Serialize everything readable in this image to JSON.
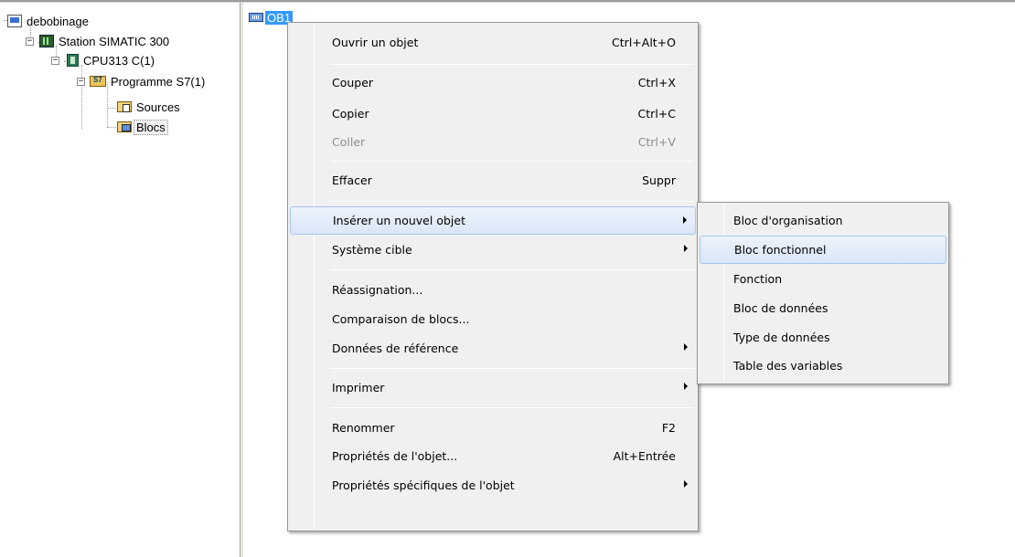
{
  "tree": {
    "project": "debobinage",
    "station": "Station SIMATIC 300",
    "cpu": "CPU313 C(1)",
    "program": "Programme S7(1)",
    "sources": "Sources",
    "blocs": "Blocs",
    "expand_minus": "−"
  },
  "content": {
    "ob1_label": "OB1"
  },
  "context_menu": {
    "items": [
      {
        "label": "Ouvrir un objet",
        "shortcut": "Ctrl+Alt+O"
      },
      {
        "label": "Couper",
        "shortcut": "Ctrl+X"
      },
      {
        "label": "Copier",
        "shortcut": "Ctrl+C"
      },
      {
        "label": "Coller",
        "shortcut": "Ctrl+V"
      },
      {
        "label": "Effacer",
        "shortcut": "Suppr"
      },
      {
        "label": "Insérer un nouvel objet",
        "shortcut": ""
      },
      {
        "label": "Système cible",
        "shortcut": ""
      },
      {
        "label": "Réassignation...",
        "shortcut": ""
      },
      {
        "label": "Comparaison de blocs...",
        "shortcut": ""
      },
      {
        "label": "Données de référence",
        "shortcut": ""
      },
      {
        "label": "Imprimer",
        "shortcut": ""
      },
      {
        "label": "Renommer",
        "shortcut": "F2"
      },
      {
        "label": "Propriétés de l'objet...",
        "shortcut": "Alt+Entrée"
      },
      {
        "label": "Propriétés spécifiques de l'objet",
        "shortcut": ""
      }
    ]
  },
  "submenu": {
    "items": [
      {
        "label": "Bloc d'organisation"
      },
      {
        "label": "Bloc fonctionnel"
      },
      {
        "label": "Fonction"
      },
      {
        "label": "Bloc de données"
      },
      {
        "label": "Type de données"
      },
      {
        "label": "Table des variables"
      }
    ]
  },
  "colors": {
    "selection": "#3399ff",
    "menu_bg": "#f0f0f0",
    "hover_border": "#a8c5ef"
  }
}
